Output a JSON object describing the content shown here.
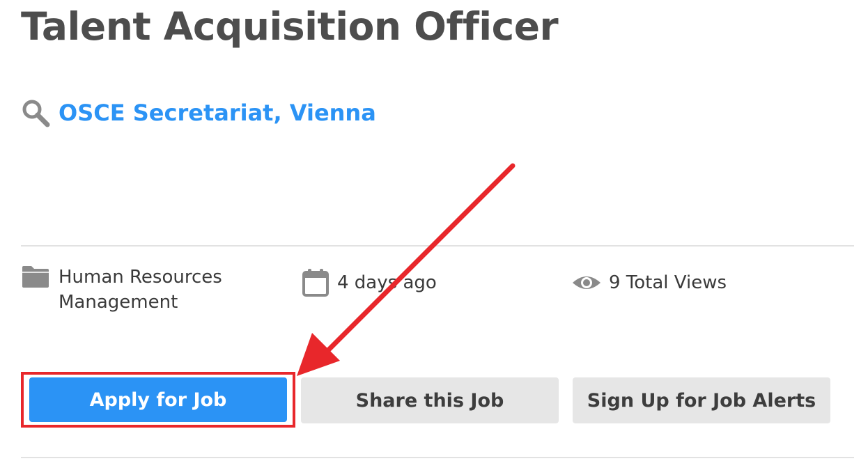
{
  "job": {
    "title": "Talent Acquisition Officer",
    "location": "OSCE Secretariat, Vienna",
    "category": "Human Resources Management",
    "posted": "4 days ago",
    "views": "9 Total Views"
  },
  "actions": {
    "apply_label": "Apply for Job",
    "share_label": "Share this Job",
    "alerts_label": "Sign Up for Job Alerts"
  },
  "icons": {
    "location": "search-icon",
    "category": "folder-icon",
    "posted": "calendar-icon",
    "views": "eye-icon"
  },
  "colors": {
    "link": "#2b93f5",
    "primary_button": "#2b93f5",
    "secondary_button": "#e6e6e6",
    "annotation": "#e8272b",
    "title": "#4d4d4d"
  }
}
